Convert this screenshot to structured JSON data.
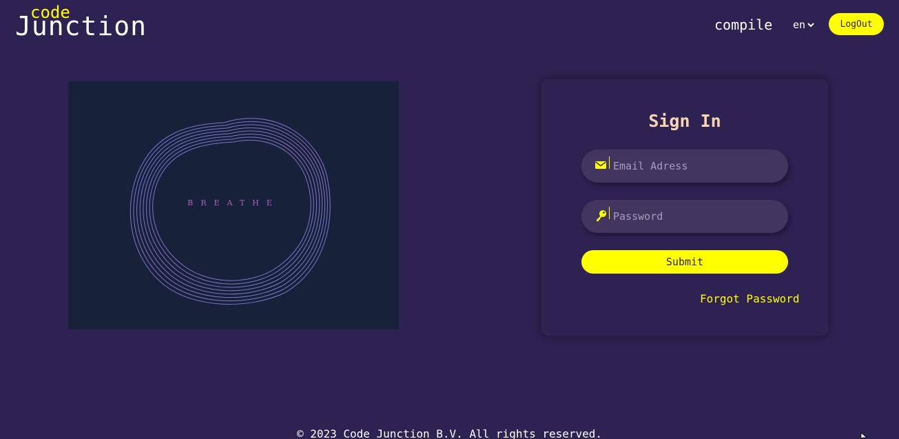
{
  "header": {
    "logo_code": "code",
    "logo_junction": "Junction",
    "nav_compile": "compile",
    "language": "en",
    "logout_label": "LogOut"
  },
  "artwork": {
    "word": "BREATHE"
  },
  "signin": {
    "title": "Sign In",
    "email_placeholder": "Email Adress",
    "email_value": "",
    "password_placeholder": "Password",
    "password_value": "",
    "submit_label": "Submit",
    "forgot_label": "Forgot Password"
  },
  "footer": {
    "copyright": "© 2023 Code Junction B.V. All rights reserved."
  },
  "colors": {
    "background": "#2e2253",
    "accent": "#ffff00",
    "title": "#fad3b0",
    "field": "#423560",
    "art_background": "#17223a"
  },
  "icons": {
    "email": "envelope-icon",
    "password": "key-icon",
    "language": "chevron-down-icon"
  }
}
